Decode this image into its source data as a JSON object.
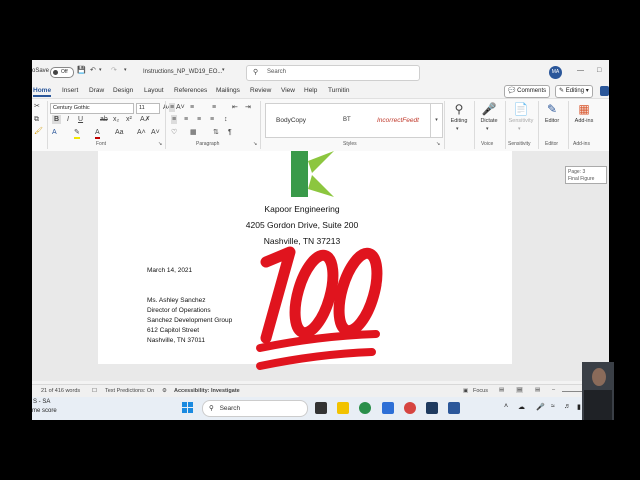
{
  "titlebar": {
    "autosave_label": "oSave",
    "autosave_state": "Off",
    "document_name": "Instructions_NP_WD19_EO...",
    "search_placeholder": "Search",
    "user_initials": "MA"
  },
  "menu": {
    "tabs": [
      "Home",
      "Insert",
      "Draw",
      "Design",
      "Layout",
      "References",
      "Mailings",
      "Review",
      "View",
      "Help",
      "Turnitin"
    ],
    "active_tab": "Home",
    "comments_label": "Comments",
    "editing_label": "Editing"
  },
  "ribbon": {
    "font_name": "Century Gothic",
    "font_size": "11",
    "font_group_label": "Font",
    "paragraph_group_label": "Paragraph",
    "styles_group_label": "Styles",
    "voice_group_label": "Voice",
    "sensitivity_group_label": "Sensitivity",
    "editor_group_label": "Editor",
    "addins_group_label": "Add-ins",
    "styles": [
      "BodyCopy",
      "BT",
      "IncorrectFeedt"
    ],
    "editing_btn": "Editing",
    "dictate_btn": "Dictate",
    "sensitivity_btn": "Sensitivity",
    "editor_btn": "Editor",
    "addins_btn": "Add-ins",
    "colors": {
      "accent": "#2b579a",
      "logo_green": "#3a9a4a",
      "incorrect_feedback": "#c0392b"
    }
  },
  "document": {
    "company": "Kapoor Engineering",
    "street": "4205 Gordon Drive, Suite 200",
    "city": "Nashville, TN 37213",
    "date": "March 14, 2021",
    "recipient": [
      "Ms. Ashley Sanchez",
      "Director of Operations",
      "Sanchez Development Group",
      "612 Capitol Street",
      "Nashville, TN 37011"
    ],
    "overlay_emoji": "100",
    "overlay_color": "#e0141e"
  },
  "tooltip": {
    "line1": "Page: 3",
    "line2": "Final Figure"
  },
  "statusbar": {
    "word_count": "21 of 416 words",
    "text_predictions": "Text Predictions: On",
    "accessibility": "Accessibility: Investigate",
    "focus": "Focus"
  },
  "taskbar": {
    "left_line1": "S - SA",
    "left_line2": "me score",
    "search_label": "Search"
  }
}
